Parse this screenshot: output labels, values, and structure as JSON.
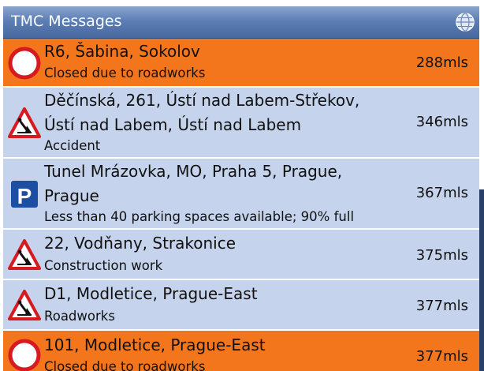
{
  "title": "TMC Messages",
  "icons": {
    "globe": "globe-icon"
  },
  "colors": {
    "orange": "#f4761c",
    "blue": "#c5d3ec",
    "header": "#5d7fb6"
  },
  "messages": [
    {
      "line1": "R6, Šabina, Sokolov",
      "line2": "",
      "sub": "Closed due to  roadworks",
      "distance": "288mls",
      "icon": "no-entry-icon"
    },
    {
      "line1": "Děčínská, 261, Ústí nad Labem-Střekov,",
      "line2": "Ústí nad Labem, Ústí nad Labem",
      "sub": "Accident",
      "distance": "346mls",
      "icon": "roadworks-warning-icon"
    },
    {
      "line1": "Tunel Mrázovka, MO, Praha 5, Prague,",
      "line2": "Prague",
      "sub": "Less than 40 parking spaces available; 90% full",
      "distance": "367mls",
      "icon": "parking-icon"
    },
    {
      "line1": "22, Vodňany, Strakonice",
      "line2": "",
      "sub": "Construction work",
      "distance": "375mls",
      "icon": "roadworks-warning-icon"
    },
    {
      "line1": "D1, Modletice, Prague-East",
      "line2": "",
      "sub": "Roadworks",
      "distance": "377mls",
      "icon": "roadworks-warning-icon"
    },
    {
      "line1": "101, Modletice, Prague-East",
      "line2": "",
      "sub": "Closed due to  roadworks",
      "distance": "377mls",
      "icon": "no-entry-icon"
    }
  ]
}
